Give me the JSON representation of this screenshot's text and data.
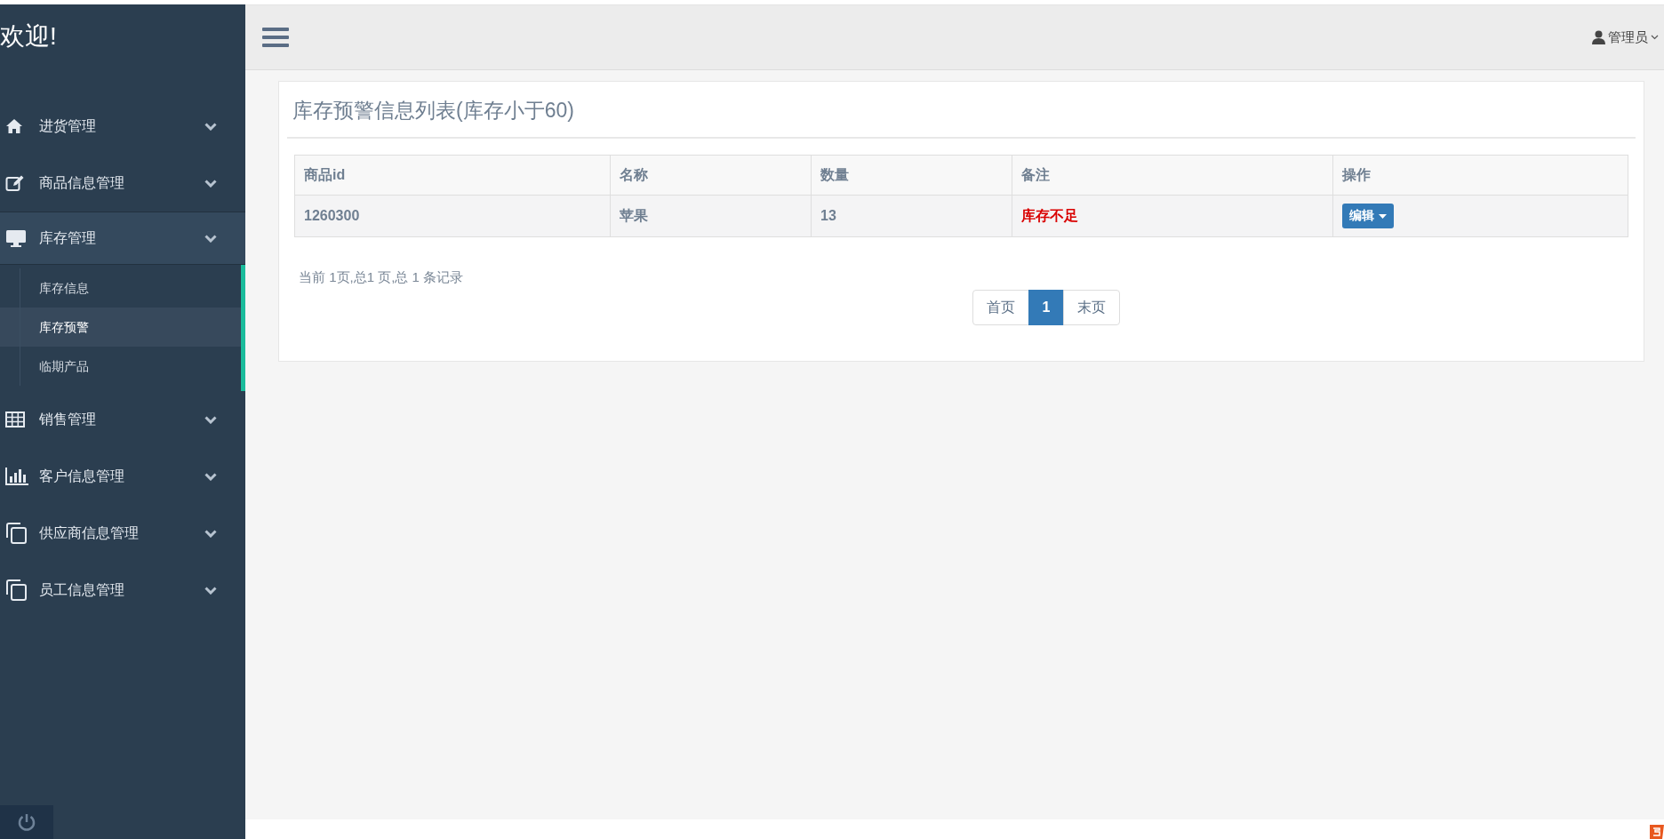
{
  "sidebar": {
    "title": "欢迎!",
    "menu": [
      {
        "label": "进货管理",
        "expanded": false
      },
      {
        "label": "商品信息管理",
        "expanded": false
      },
      {
        "label": "库存管理",
        "expanded": true,
        "children": [
          {
            "label": "库存信息",
            "selected": false
          },
          {
            "label": "库存预警",
            "selected": true
          },
          {
            "label": "临期产品",
            "selected": false
          }
        ]
      },
      {
        "label": "销售管理",
        "expanded": false
      },
      {
        "label": "客户信息管理",
        "expanded": false
      },
      {
        "label": "供应商信息管理",
        "expanded": false
      },
      {
        "label": "员工信息管理",
        "expanded": false
      }
    ]
  },
  "header": {
    "user": "管理员"
  },
  "panel": {
    "title": "库存预警信息列表(库存小于60)",
    "table": {
      "columns": [
        "商品id",
        "名称",
        "数量",
        "备注",
        "操作"
      ],
      "rows": [
        {
          "cells": [
            "1260300",
            "苹果",
            "13",
            "库存不足"
          ],
          "action": "编辑"
        }
      ]
    },
    "summary": "当前 1页,总1 页,总 1 条记录",
    "pagination": [
      {
        "label": "首页",
        "selected": false
      },
      {
        "label": "1",
        "selected": true
      },
      {
        "label": "末页",
        "selected": false
      }
    ]
  }
}
